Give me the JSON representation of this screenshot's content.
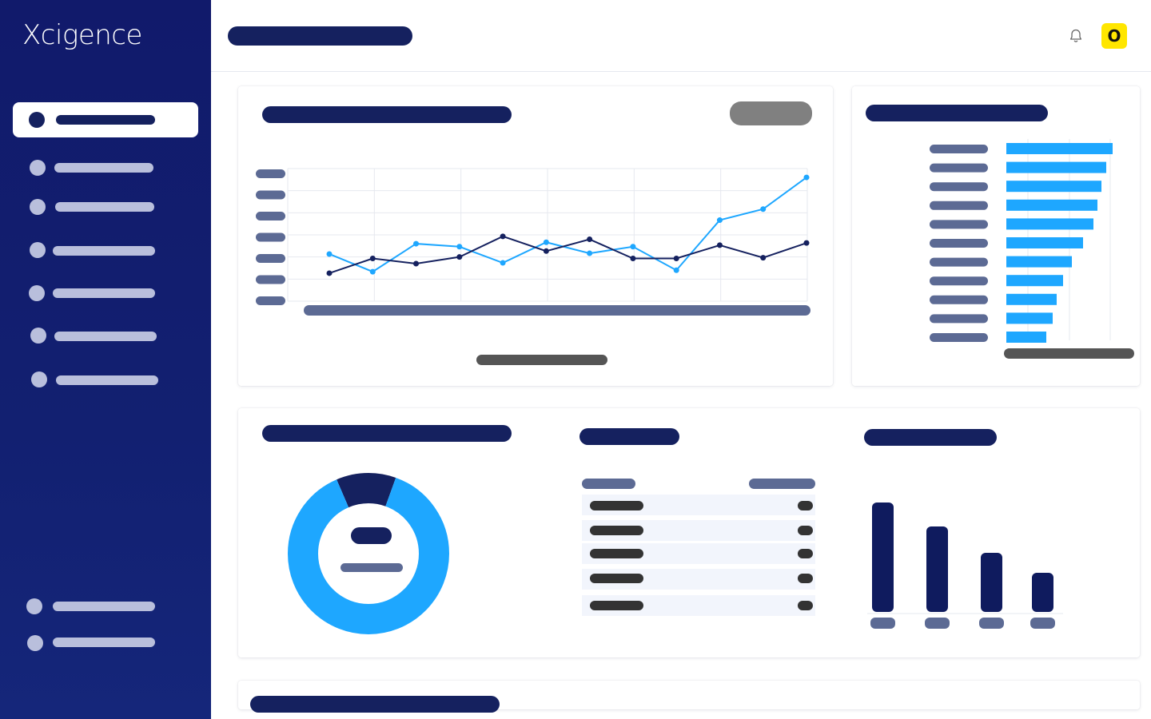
{
  "app": {
    "logo": "Xcigence",
    "avatar_initial": "O"
  },
  "colors": {
    "sidebar": "#111a6b",
    "navy": "#15215f",
    "accent_blue": "#1ea7ff",
    "slate": "#5c6a94",
    "avatar": "#ffe600"
  },
  "icons": {
    "notifications": "bell-icon"
  },
  "sidebar": {
    "top_item_count": 7,
    "bottom_item_count": 2,
    "active_index": 0
  },
  "charts": {
    "line": {
      "type": "line",
      "series": [
        {
          "color": "#1ea7ff",
          "values": [
            64,
            40,
            78,
            74,
            52,
            80,
            65,
            74,
            42,
            110,
            125,
            168
          ]
        },
        {
          "color": "#15215f",
          "values": [
            38,
            58,
            51,
            60,
            88,
            68,
            84,
            58,
            58,
            76,
            59,
            79
          ]
        }
      ]
    },
    "hbar": {
      "type": "bar",
      "orientation": "horizontal",
      "color": "#1ea7ff",
      "values": [
        133,
        125,
        119,
        114,
        109,
        96,
        82,
        71,
        63,
        58,
        50
      ]
    },
    "donut": {
      "type": "pie",
      "slices": [
        {
          "color": "#15215f",
          "value": 0.12
        },
        {
          "color": "#1ea7ff",
          "value": 0.88
        }
      ]
    },
    "vbar": {
      "type": "bar",
      "color": "#0f1b5e",
      "values": [
        137,
        107,
        74,
        49
      ]
    }
  },
  "table": {
    "row_count": 5
  }
}
